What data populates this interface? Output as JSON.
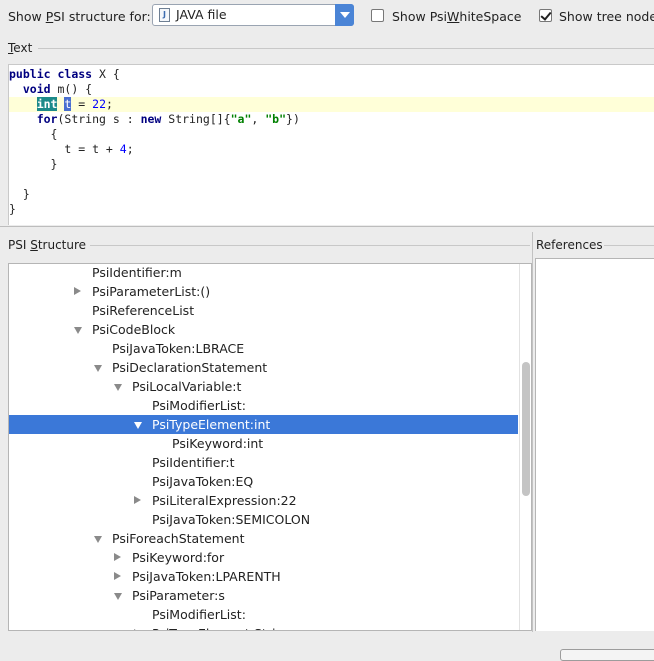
{
  "toolbar": {
    "show_label_pre": "Show ",
    "show_label_mnemonic": "P",
    "show_label_post": "SI structure for:",
    "file_type_value": "JAVA file",
    "file_type_icon": "java-file-icon",
    "whitespace_label_pre": "Show Psi",
    "whitespace_label_mnemonic": "W",
    "whitespace_label_post": "hiteSpace",
    "whitespace_checked": false,
    "tree_nodes_label": "Show tree node",
    "tree_nodes_checked": true
  },
  "text_section": {
    "label_mnemonic": "T",
    "label_rest": "ext"
  },
  "code": {
    "lines": [
      [
        {
          "t": "public",
          "c": "kw"
        },
        {
          "t": " "
        },
        {
          "t": "class",
          "c": "kw"
        },
        {
          "t": " X {"
        }
      ],
      [
        {
          "t": "  "
        },
        {
          "t": "void",
          "c": "kw"
        },
        {
          "t": " m() {"
        }
      ],
      [
        {
          "t": "    "
        },
        {
          "t": "int",
          "c": "hl"
        },
        {
          "t": " "
        },
        {
          "t": "t",
          "c": "sel"
        },
        {
          "t": " = "
        },
        {
          "t": "22",
          "c": "num"
        },
        {
          "t": ";"
        }
      ],
      [
        {
          "t": "    "
        },
        {
          "t": "for",
          "c": "kw"
        },
        {
          "t": "(String s : "
        },
        {
          "t": "new",
          "c": "kw"
        },
        {
          "t": " String[]{"
        },
        {
          "t": "\"a\"",
          "c": "str"
        },
        {
          "t": ", "
        },
        {
          "t": "\"b\"",
          "c": "str"
        },
        {
          "t": "})"
        }
      ],
      [
        {
          "t": "      {"
        }
      ],
      [
        {
          "t": "        t = t + "
        },
        {
          "t": "4",
          "c": "num"
        },
        {
          "t": ";"
        }
      ],
      [
        {
          "t": "      }"
        }
      ],
      [
        {
          "t": ""
        }
      ],
      [
        {
          "t": "  }"
        }
      ],
      [
        {
          "t": "}"
        }
      ]
    ],
    "current_line_index": 2
  },
  "psi_section": {
    "label_pre": "PSI ",
    "label_mnemonic": "S",
    "label_post": "tructure"
  },
  "references_section": {
    "label": "References"
  },
  "tree": {
    "rows": [
      {
        "label": "PsiIdentifier:m",
        "depth": 3,
        "expander": "none"
      },
      {
        "label": "PsiParameterList:()",
        "depth": 3,
        "expander": "collapsed"
      },
      {
        "label": "PsiReferenceList",
        "depth": 3,
        "expander": "none"
      },
      {
        "label": "PsiCodeBlock",
        "depth": 3,
        "expander": "expanded"
      },
      {
        "label": "PsiJavaToken:LBRACE",
        "depth": 4,
        "expander": "none"
      },
      {
        "label": "PsiDeclarationStatement",
        "depth": 4,
        "expander": "expanded"
      },
      {
        "label": "PsiLocalVariable:t",
        "depth": 5,
        "expander": "expanded"
      },
      {
        "label": "PsiModifierList:",
        "depth": 6,
        "expander": "none"
      },
      {
        "label": "PsiTypeElement:int",
        "depth": 6,
        "expander": "expanded",
        "selected": true
      },
      {
        "label": "PsiKeyword:int",
        "depth": 7,
        "expander": "none"
      },
      {
        "label": "PsiIdentifier:t",
        "depth": 6,
        "expander": "none"
      },
      {
        "label": "PsiJavaToken:EQ",
        "depth": 6,
        "expander": "none"
      },
      {
        "label": "PsiLiteralExpression:22",
        "depth": 6,
        "expander": "collapsed"
      },
      {
        "label": "PsiJavaToken:SEMICOLON",
        "depth": 6,
        "expander": "none"
      },
      {
        "label": "PsiForeachStatement",
        "depth": 4,
        "expander": "expanded"
      },
      {
        "label": "PsiKeyword:for",
        "depth": 5,
        "expander": "collapsed"
      },
      {
        "label": "PsiJavaToken:LPARENTH",
        "depth": 5,
        "expander": "collapsed"
      },
      {
        "label": "PsiParameter:s",
        "depth": 5,
        "expander": "expanded"
      },
      {
        "label": "PsiModifierList:",
        "depth": 6,
        "expander": "none"
      },
      {
        "label": "PsiTypeElement:String",
        "depth": 6,
        "expander": "collapsed"
      }
    ]
  },
  "colors": {
    "selection": "#3b78d8",
    "keyword": "#000080",
    "number": "#0000ff",
    "string": "#008000",
    "highlight": "#1c8a8a"
  }
}
